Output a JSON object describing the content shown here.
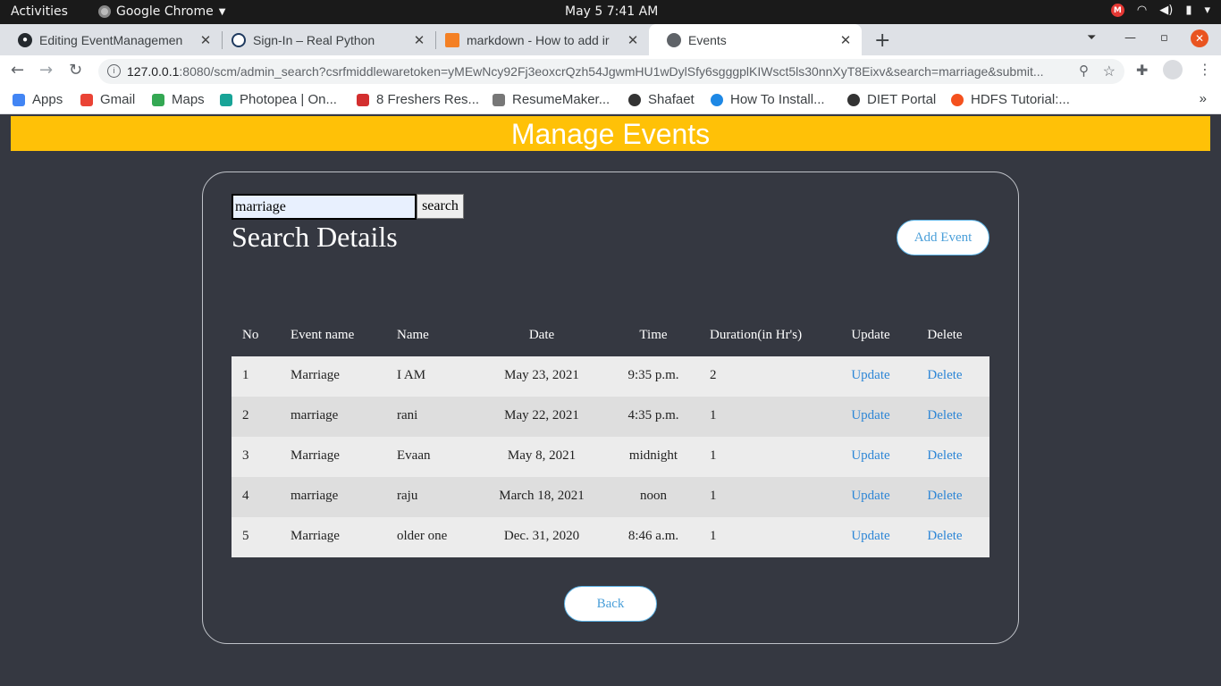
{
  "system": {
    "activities_label": "Activities",
    "app_label": "Google Chrome",
    "clock": "May 5  7:41 AM"
  },
  "browser": {
    "tabs": [
      {
        "title": "Editing EventManagemen",
        "icon": "github-icon"
      },
      {
        "title": "Sign-In – Real Python",
        "icon": "realpython-icon"
      },
      {
        "title": "markdown - How to add ir",
        "icon": "stackoverflow-icon"
      },
      {
        "title": "Events",
        "icon": "globe-icon"
      }
    ],
    "url_host": "127.0.0.1",
    "url_rest": ":8080/scm/admin_search?csrfmiddlewaretoken=yMEwNcy92Fj3eoxcrQzh54JgwmHU1wDylSfy6sgggplKIWsct5ls30nnXyT8Eixv&search=marriage&submit...",
    "bookmarks": [
      {
        "label": "Apps",
        "color": "#4285f4"
      },
      {
        "label": "Gmail",
        "color": "#ea4335"
      },
      {
        "label": "Maps",
        "color": "#34a853"
      },
      {
        "label": "Photopea | On...",
        "color": "#18a497"
      },
      {
        "label": "8 Freshers Res...",
        "color": "#d32f2f"
      },
      {
        "label": "ResumeMaker...",
        "color": "#555555"
      },
      {
        "label": "Shafaet",
        "color": "#333333"
      },
      {
        "label": "How To Install...",
        "color": "#1e88e5"
      },
      {
        "label": "DIET Portal",
        "color": "#333333"
      },
      {
        "label": "HDFS Tutorial:...",
        "color": "#f4511e"
      }
    ]
  },
  "page": {
    "banner_title": "Manage Events",
    "search_value": "marriage",
    "search_button": "search",
    "heading": "Search Details",
    "add_button": "Add Event",
    "back_button": "Back",
    "columns": {
      "no": "No",
      "event_name": "Event name",
      "name": "Name",
      "date": "Date",
      "time": "Time",
      "duration": "Duration(in Hr's)",
      "update": "Update",
      "delete": "Delete"
    },
    "rows": [
      {
        "no": "1",
        "event_name": "Marriage",
        "name": "I AM",
        "date": "May 23, 2021",
        "time": "9:35 p.m.",
        "duration": "2",
        "update": "Update",
        "delete": "Delete"
      },
      {
        "no": "2",
        "event_name": "marriage",
        "name": "rani",
        "date": "May 22, 2021",
        "time": "4:35 p.m.",
        "duration": "1",
        "update": "Update",
        "delete": "Delete"
      },
      {
        "no": "3",
        "event_name": "Marriage",
        "name": "Evaan",
        "date": "May 8, 2021",
        "time": "midnight",
        "duration": "1",
        "update": "Update",
        "delete": "Delete"
      },
      {
        "no": "4",
        "event_name": "marriage",
        "name": "raju",
        "date": "March 18, 2021",
        "time": "noon",
        "duration": "1",
        "update": "Update",
        "delete": "Delete"
      },
      {
        "no": "5",
        "event_name": "Marriage",
        "name": "older one",
        "date": "Dec. 31, 2020",
        "time": "8:46 a.m.",
        "duration": "1",
        "update": "Update",
        "delete": "Delete"
      }
    ]
  },
  "colors": {
    "banner": "#ffc107",
    "background": "#353841",
    "link": "#2d86d6"
  }
}
